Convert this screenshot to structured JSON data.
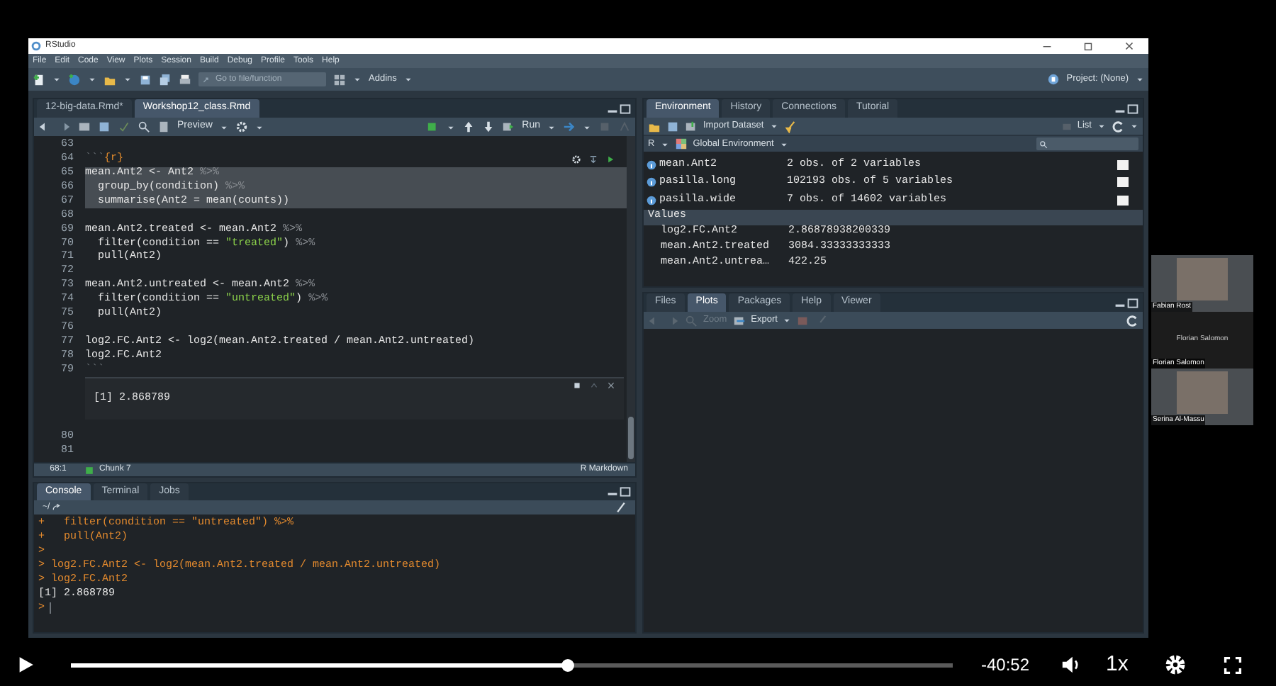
{
  "window": {
    "title": "RStudio"
  },
  "menu": [
    "File",
    "Edit",
    "Code",
    "View",
    "Plots",
    "Session",
    "Build",
    "Debug",
    "Profile",
    "Tools",
    "Help"
  ],
  "toolbar": {
    "goto_placeholder": "Go to file/function",
    "addins": "Addins",
    "project": "Project: (None)"
  },
  "editor": {
    "tabs": [
      {
        "label": "12-big-data.Rmd*",
        "selected": false
      },
      {
        "label": "Workshop12_class.Rmd",
        "selected": true
      }
    ],
    "toolbar": {
      "preview": "Preview",
      "run": "Run"
    },
    "lines": [
      {
        "number": "63",
        "highlighted": false
      },
      {
        "number": "64",
        "highlighted": false,
        "segments": [
          {
            "kind": "fence",
            "text": "```"
          },
          {
            "kind": "chunk",
            "text": "{r}"
          }
        ]
      },
      {
        "number": "65",
        "highlighted": true,
        "segments": [
          {
            "kind": "plain",
            "text": "mean.Ant2 <- Ant2 "
          },
          {
            "kind": "op",
            "text": "%>%"
          }
        ]
      },
      {
        "number": "66",
        "highlighted": true,
        "segments": [
          {
            "kind": "plain",
            "text": "  group_by(condition) "
          },
          {
            "kind": "op",
            "text": "%>%"
          }
        ]
      },
      {
        "number": "67",
        "highlighted": true,
        "segments": [
          {
            "kind": "plain",
            "text": "  summarise(Ant2 = mean(counts))"
          }
        ]
      },
      {
        "number": "68",
        "highlighted": false
      },
      {
        "number": "69",
        "highlighted": false,
        "segments": [
          {
            "kind": "plain",
            "text": "mean.Ant2.treated <- mean.Ant2 "
          },
          {
            "kind": "op",
            "text": "%>%"
          }
        ]
      },
      {
        "number": "70",
        "highlighted": false,
        "segments": [
          {
            "kind": "plain",
            "text": "  filter(condition == "
          },
          {
            "kind": "string",
            "text": "\"treated\""
          },
          {
            "kind": "plain",
            "text": ") "
          },
          {
            "kind": "op",
            "text": "%>%"
          }
        ]
      },
      {
        "number": "71",
        "highlighted": false,
        "segments": [
          {
            "kind": "plain",
            "text": "  pull(Ant2)"
          }
        ]
      },
      {
        "number": "72",
        "highlighted": false
      },
      {
        "number": "73",
        "highlighted": false,
        "segments": [
          {
            "kind": "plain",
            "text": "mean.Ant2.untreated <- mean.Ant2 "
          },
          {
            "kind": "op",
            "text": "%>%"
          }
        ]
      },
      {
        "number": "74",
        "highlighted": false,
        "segments": [
          {
            "kind": "plain",
            "text": "  filter(condition == "
          },
          {
            "kind": "string",
            "text": "\"untreated\""
          },
          {
            "kind": "plain",
            "text": ") "
          },
          {
            "kind": "op",
            "text": "%>%"
          }
        ]
      },
      {
        "number": "75",
        "highlighted": false,
        "segments": [
          {
            "kind": "plain",
            "text": "  pull(Ant2)"
          }
        ]
      },
      {
        "number": "76",
        "highlighted": false
      },
      {
        "number": "77",
        "highlighted": false,
        "segments": [
          {
            "kind": "plain",
            "text": "log2.FC.Ant2 <- log2(mean.Ant2.treated / mean.Ant2.untreated)"
          }
        ]
      },
      {
        "number": "78",
        "highlighted": false,
        "segments": [
          {
            "kind": "plain",
            "text": "log2.FC.Ant2"
          }
        ]
      },
      {
        "number": "79",
        "highlighted": false,
        "segments": [
          {
            "kind": "fence",
            "text": "```"
          }
        ]
      }
    ],
    "chunk_output": "[1] 2.868789",
    "lines_after": [
      "80",
      "81"
    ],
    "status": {
      "position": "68:1",
      "chunk": "Chunk 7",
      "mode": "R Markdown"
    }
  },
  "console": {
    "tabs": [
      {
        "label": "Console",
        "selected": true
      },
      {
        "label": "Terminal",
        "selected": false
      },
      {
        "label": "Jobs",
        "selected": false
      }
    ],
    "path": "~/",
    "lines": [
      {
        "kind": "input",
        "text": "+   filter(condition == \"untreated\") %>%",
        "cursor": false
      },
      {
        "kind": "input",
        "text": "+   pull(Ant2)",
        "cursor": false
      },
      {
        "kind": "input",
        "text": ">",
        "cursor": false
      },
      {
        "kind": "input",
        "text": "> log2.FC.Ant2 <- log2(mean.Ant2.treated / mean.Ant2.untreated)",
        "cursor": false
      },
      {
        "kind": "input",
        "text": "> log2.FC.Ant2",
        "cursor": false
      },
      {
        "kind": "output",
        "text": "[1] 2.868789",
        "cursor": false
      },
      {
        "kind": "input",
        "text": ">",
        "cursor": true
      }
    ]
  },
  "environment": {
    "tabs": [
      {
        "label": "Environment",
        "selected": true
      },
      {
        "label": "History",
        "selected": false
      },
      {
        "label": "Connections",
        "selected": false
      },
      {
        "label": "Tutorial",
        "selected": false
      }
    ],
    "toolbar": {
      "import": "Import Dataset",
      "view": "List",
      "language": "R",
      "scope": "Global Environment"
    },
    "data_rows": [
      {
        "name": "mean.Ant2",
        "value": "2 obs. of 2 variables"
      },
      {
        "name": "pasilla.long",
        "value": "102193 obs. of 5 variables"
      },
      {
        "name": "pasilla.wide",
        "value": "7 obs. of 14602 variables"
      }
    ],
    "values_header": "Values",
    "value_rows": [
      {
        "name": "log2.FC.Ant2",
        "value": "2.86878938200339"
      },
      {
        "name": "mean.Ant2.treated",
        "value": "3084.33333333333"
      },
      {
        "name": "mean.Ant2.untrea…",
        "value": "422.25"
      }
    ]
  },
  "files_pane": {
    "tabs": [
      {
        "label": "Files",
        "selected": false
      },
      {
        "label": "Plots",
        "selected": true
      },
      {
        "label": "Packages",
        "selected": false
      },
      {
        "label": "Help",
        "selected": false
      },
      {
        "label": "Viewer",
        "selected": false
      }
    ],
    "toolbar": {
      "zoom": "Zoom",
      "export": "Export"
    }
  },
  "participants": [
    {
      "kind": "camera",
      "name": "Fabian Rost"
    },
    {
      "kind": "no_camera",
      "name": "Florian Salomon",
      "center_label": "Florian Salomon"
    },
    {
      "kind": "camera",
      "name": "Serina Al-Massu"
    }
  ],
  "player": {
    "level": 0.563,
    "time": "-40:52",
    "speed": "1x"
  }
}
